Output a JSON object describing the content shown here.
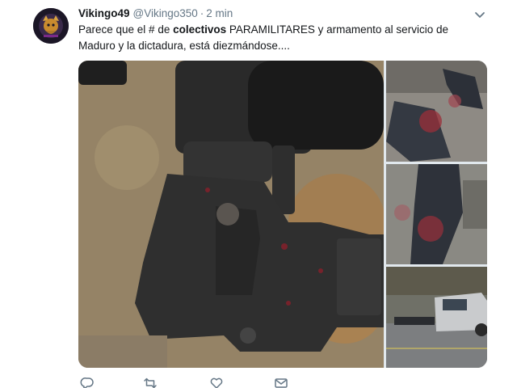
{
  "tweet": {
    "display_name": "Vikingo49",
    "handle": "@Vikingo350",
    "separator": "·",
    "time": "2 min",
    "text_part1": "Parece que el # de ",
    "text_bold": "colectivos",
    "text_part2": " PARAMILITARES y armamento al servicio de Maduro y la dictadura, está diezmándose...."
  },
  "icons": {
    "avatar": "avatar-image",
    "caret": "chevron-down-icon",
    "reply": "reply-icon",
    "retweet": "retweet-icon",
    "like": "heart-icon",
    "dm": "envelope-icon"
  },
  "colors": {
    "text": "#14171a",
    "secondary": "#657786",
    "icon": "#657786",
    "border": "#e1e8ed"
  }
}
